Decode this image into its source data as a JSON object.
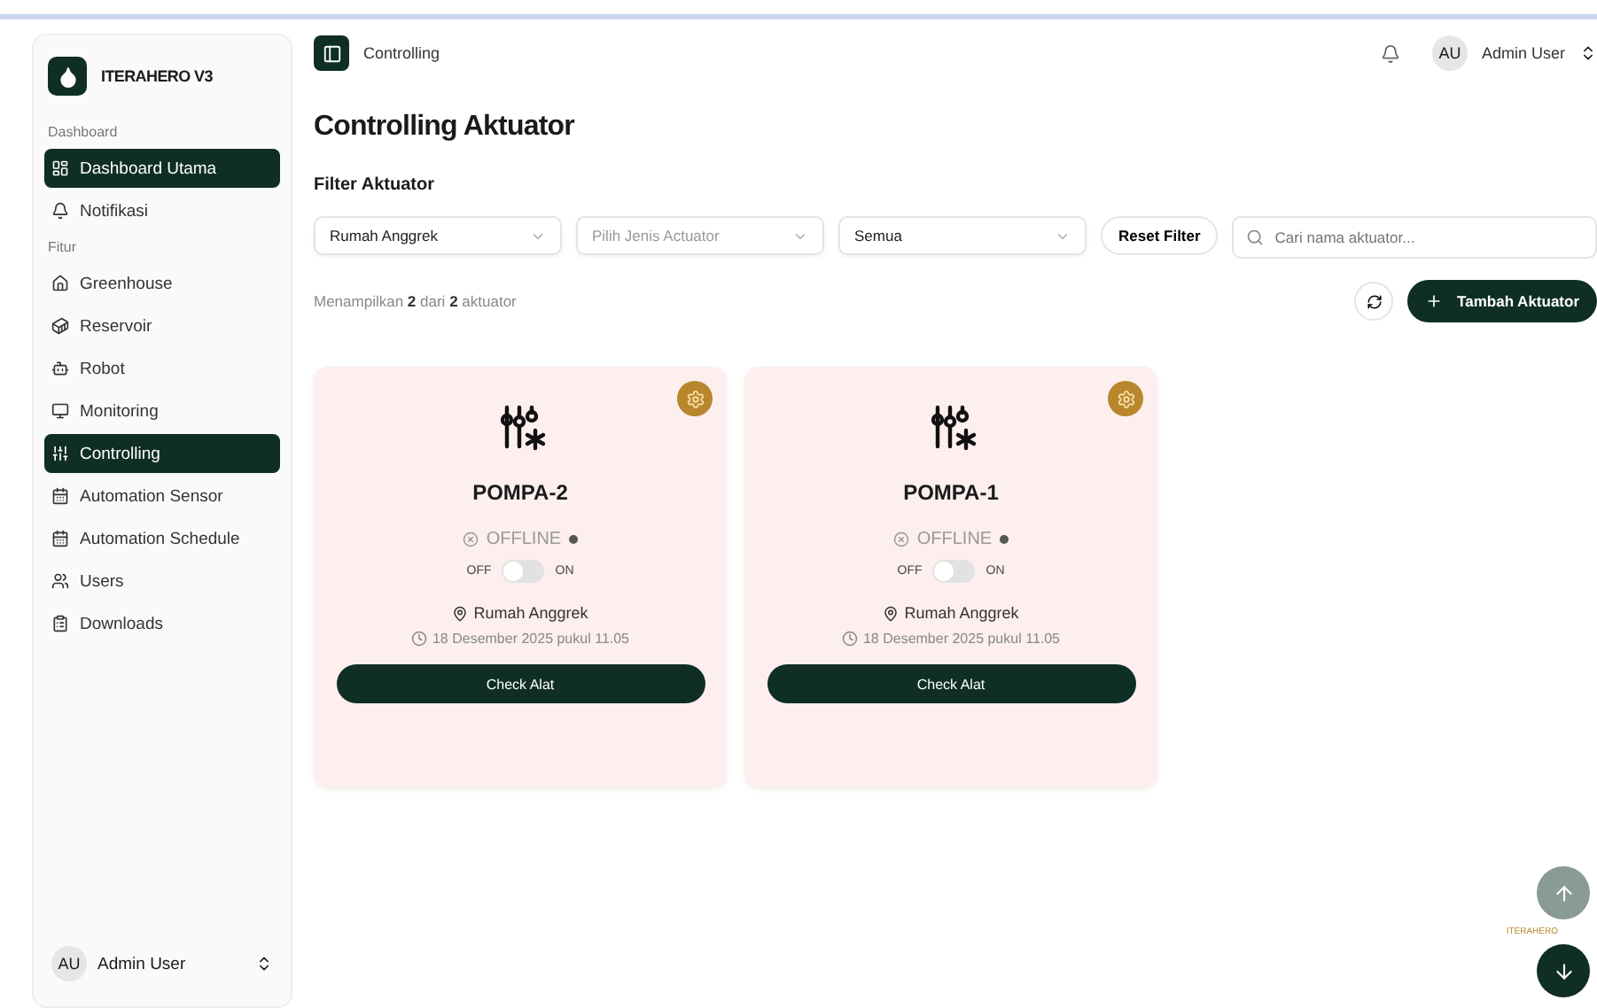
{
  "app": {
    "title": "ITERAHERO V3"
  },
  "sidebar": {
    "sections": [
      {
        "label": "Dashboard",
        "items": [
          {
            "label": "Dashboard Utama",
            "selected": true
          },
          {
            "label": "Notifikasi",
            "selected": false
          }
        ]
      },
      {
        "label": "Fitur",
        "items": [
          {
            "label": "Greenhouse",
            "selected": false
          },
          {
            "label": "Reservoir",
            "selected": false
          },
          {
            "label": "Robot",
            "selected": false
          },
          {
            "label": "Monitoring",
            "selected": false
          },
          {
            "label": "Controlling",
            "selected": true
          },
          {
            "label": "Automation Sensor",
            "selected": false
          },
          {
            "label": "Automation Schedule",
            "selected": false
          },
          {
            "label": "Users",
            "selected": false
          },
          {
            "label": "Downloads",
            "selected": false
          }
        ]
      }
    ],
    "user": {
      "initials": "AU",
      "name": "Admin User"
    }
  },
  "header": {
    "breadcrumb": "Controlling",
    "user": {
      "initials": "AU",
      "name": "Admin User"
    }
  },
  "page": {
    "title": "Controlling Aktuator",
    "filter_title": "Filter Aktuator",
    "filters": [
      {
        "value": "Rumah Anggrek"
      },
      {
        "placeholder": "Pilih Jenis Actuator"
      },
      {
        "value": "Semua"
      }
    ],
    "reset_button": "Reset Filter",
    "search": {
      "placeholder": "Cari nama aktuator..."
    },
    "summary": "Menampilkan **2** dari **2** aktuator",
    "add_button": "Tambah Aktuator"
  },
  "cards": [
    {
      "name": "POMPA-2",
      "status": "OFFLINE",
      "off_label": "OFF",
      "on_label": "ON",
      "on": false,
      "location": "Rumah Anggrek",
      "time": "18 Desember 2025 pukul 11.05",
      "button": "Check Alat"
    },
    {
      "name": "POMPA-1",
      "status": "OFFLINE",
      "off_label": "OFF",
      "on_label": "ON",
      "on": false,
      "location": "Rumah Anggrek",
      "time": "18 Desember 2025 pukul 11.05",
      "button": "Check Alat"
    }
  ],
  "floating_logo": "ITERAHERO"
}
